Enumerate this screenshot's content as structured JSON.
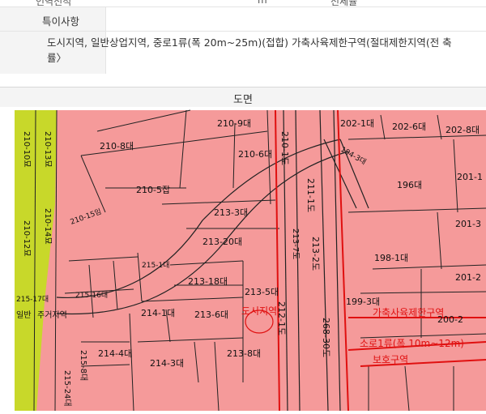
{
  "top_row": {
    "left_cut": "인역전적",
    "mid_cut": "m²",
    "right_cut": "전세율"
  },
  "special_row": {
    "label": "특이사항"
  },
  "zoning_row": {
    "line1": "도시지역, 일반상업지역, 중로1류(폭 20m~25m)(접합) 가축사육제한구역(절대제한지역(전 축",
    "line2": "률〉"
  },
  "drawing_section": {
    "title": "도면"
  },
  "map": {
    "colors": {
      "zone_fill": "#f59a9a",
      "green_strip": "#c8d82a",
      "boundary": "#e01010",
      "lot_line": "#222222"
    },
    "parcels": [
      "210-9대",
      "210-8대",
      "210-6대",
      "210-1도",
      "202-1대",
      "202-6대",
      "202-8대",
      "194-3대",
      "201-1",
      "210-5잡",
      "211-1도",
      "196대",
      "201-3",
      "210-15임",
      "213-3대",
      "213-7도",
      "198-1대",
      "213-20대",
      "215-1대",
      "213-2도",
      "201-2",
      "215-16대",
      "213-18대",
      "213-5대",
      "199-3대",
      "215-17대",
      "214-1대",
      "213-6대",
      "212-1도",
      "200-2",
      "214-4대",
      "214-3대",
      "213-8대",
      "268-30도",
      "215-8대",
      "215-24대",
      "210-10묘",
      "210-13묘",
      "210-12묘",
      "210-14묘"
    ],
    "overlays": {
      "city_zone": "도시지역",
      "livestock_zone": "가축사육제한구역",
      "road_label": "소로1류(폭 10m~12m)",
      "protect_zone": "보호구역",
      "left_label_a": "일반",
      "left_label_b": "주거지역"
    }
  }
}
